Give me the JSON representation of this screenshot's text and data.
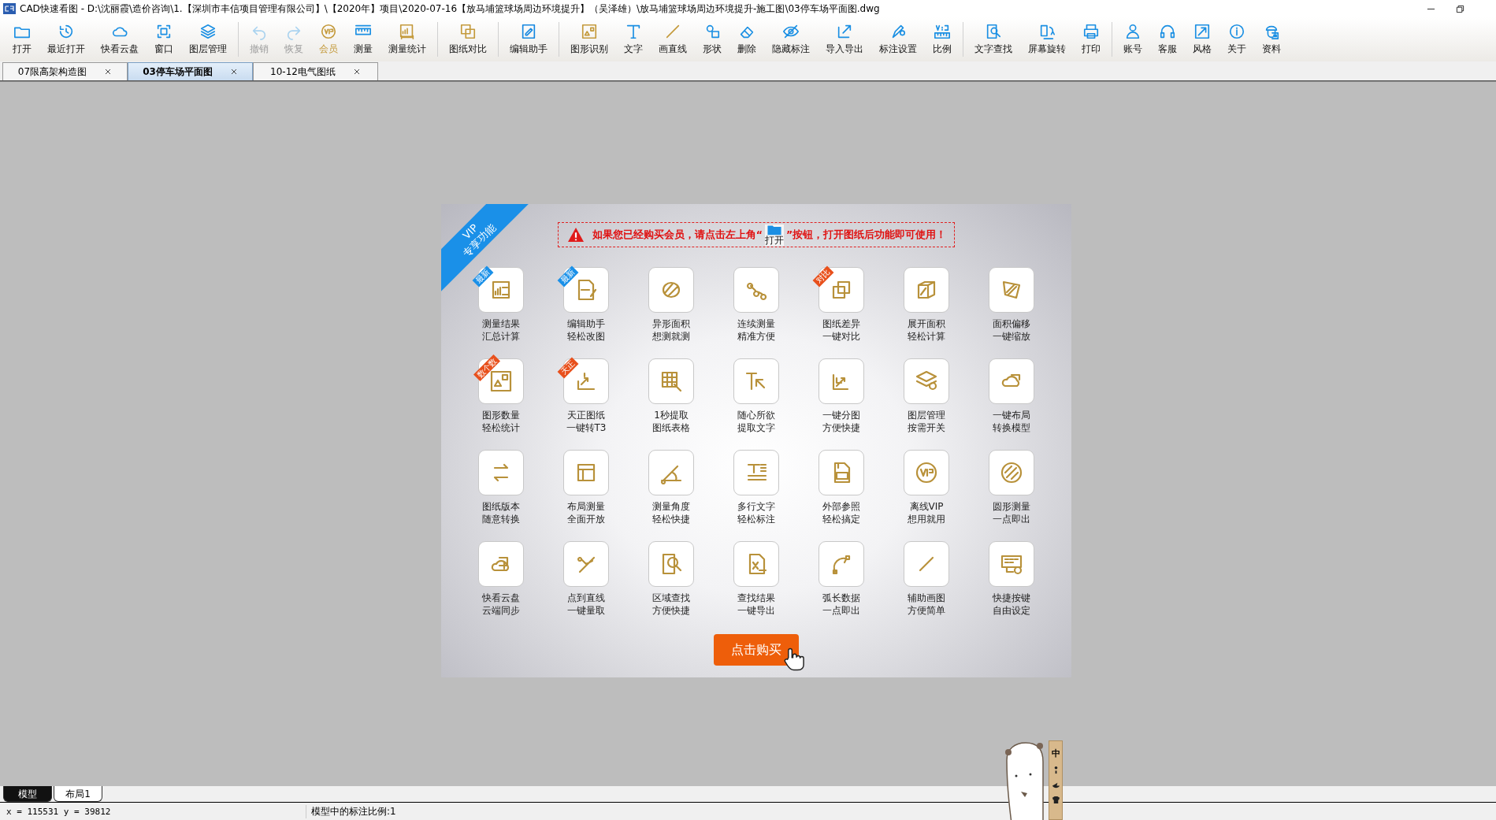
{
  "window": {
    "title": "CAD快速看图 - D:\\沈丽霞\\造价咨询\\1.【深圳市丰信项目管理有限公司】\\【2020年】项目\\2020-07-16【放马埔篮球场周边环境提升】（吴泽雄）\\放马埔篮球场周边环境提升-施工图\\03停车场平面图.dwg"
  },
  "toolbar": [
    {
      "label": "打开",
      "kind": "normal",
      "disabled": false,
      "group_end": false
    },
    {
      "label": "最近打开",
      "kind": "normal",
      "disabled": false,
      "group_end": false
    },
    {
      "label": "快看云盘",
      "kind": "normal",
      "disabled": false,
      "group_end": false
    },
    {
      "label": "窗口",
      "kind": "normal",
      "disabled": false,
      "group_end": false
    },
    {
      "label": "图层管理",
      "kind": "normal",
      "disabled": false,
      "group_end": true
    },
    {
      "label": "撤销",
      "kind": "normal",
      "disabled": true,
      "group_end": false
    },
    {
      "label": "恢复",
      "kind": "normal",
      "disabled": true,
      "group_end": false
    },
    {
      "label": "会员",
      "kind": "member",
      "disabled": false,
      "group_end": false
    },
    {
      "label": "测量",
      "kind": "normal",
      "disabled": false,
      "group_end": false
    },
    {
      "label": "测量统计",
      "kind": "vip",
      "disabled": false,
      "group_end": true
    },
    {
      "label": "图纸对比",
      "kind": "vip",
      "disabled": false,
      "group_end": true
    },
    {
      "label": "编辑助手",
      "kind": "badge",
      "disabled": false,
      "group_end": true
    },
    {
      "label": "图形识别",
      "kind": "vip",
      "disabled": false,
      "group_end": false
    },
    {
      "label": "文字",
      "kind": "normal",
      "disabled": false,
      "group_end": false
    },
    {
      "label": "画直线",
      "kind": "vip",
      "disabled": false,
      "group_end": false
    },
    {
      "label": "形状",
      "kind": "normal",
      "disabled": false,
      "group_end": false
    },
    {
      "label": "删除",
      "kind": "normal",
      "disabled": false,
      "group_end": false
    },
    {
      "label": "隐藏标注",
      "kind": "normal",
      "disabled": false,
      "group_end": false
    },
    {
      "label": "导入导出",
      "kind": "normal",
      "disabled": false,
      "group_end": false
    },
    {
      "label": "标注设置",
      "kind": "normal",
      "disabled": false,
      "group_end": false
    },
    {
      "label": "比例",
      "kind": "normal",
      "disabled": false,
      "group_end": true
    },
    {
      "label": "文字查找",
      "kind": "normal",
      "disabled": false,
      "group_end": false
    },
    {
      "label": "屏幕旋转",
      "kind": "normal",
      "disabled": false,
      "group_end": false
    },
    {
      "label": "打印",
      "kind": "normal",
      "disabled": false,
      "group_end": true
    },
    {
      "label": "账号",
      "kind": "normal",
      "disabled": false,
      "group_end": false
    },
    {
      "label": "客服",
      "kind": "normal",
      "disabled": false,
      "group_end": false
    },
    {
      "label": "风格",
      "kind": "normal",
      "disabled": false,
      "group_end": false
    },
    {
      "label": "关于",
      "kind": "normal",
      "disabled": false,
      "group_end": false
    },
    {
      "label": "资料",
      "kind": "normal",
      "disabled": false,
      "group_end": false
    }
  ],
  "tabs": [
    {
      "label": "07限高架构造图",
      "selected": false
    },
    {
      "label": "03停车场平面图",
      "selected": true
    },
    {
      "label": "10-12电气图纸",
      "selected": false
    }
  ],
  "vip_panel": {
    "ribbon": [
      "VIP",
      "专享功能"
    ],
    "notice": {
      "before": "如果您已经购买会员，请点击左上角“",
      "button_label": "打开",
      "after": "”按钮，打开图纸后功能即可使用！"
    },
    "features": [
      {
        "lines": [
          "测量结果",
          "汇总计算"
        ],
        "badge": {
          "text": "最新",
          "color": "#1a90e8"
        }
      },
      {
        "lines": [
          "编辑助手",
          "轻松改图"
        ],
        "badge": {
          "text": "最新",
          "color": "#1a90e8"
        }
      },
      {
        "lines": [
          "异形面积",
          "想测就测"
        ]
      },
      {
        "lines": [
          "连续测量",
          "精准方便"
        ]
      },
      {
        "lines": [
          "图纸差异",
          "一键对比"
        ],
        "badge": {
          "text": "对比",
          "color": "#e8501c"
        }
      },
      {
        "lines": [
          "展开面积",
          "轻松计算"
        ]
      },
      {
        "lines": [
          "面积偏移",
          "一键缩放"
        ]
      },
      {
        "lines": [
          "图形数量",
          "轻松统计"
        ],
        "badge": {
          "text": "数个数",
          "color": "#e8501c"
        }
      },
      {
        "lines": [
          "天正图纸",
          "一键转T3"
        ],
        "badge": {
          "text": "天正",
          "color": "#e8501c"
        }
      },
      {
        "lines": [
          "1秒提取",
          "图纸表格"
        ]
      },
      {
        "lines": [
          "随心所欲",
          "提取文字"
        ]
      },
      {
        "lines": [
          "一键分图",
          "方便快捷"
        ]
      },
      {
        "lines": [
          "图层管理",
          "按需开关"
        ]
      },
      {
        "lines": [
          "一键布局",
          "转换模型"
        ]
      },
      {
        "lines": [
          "图纸版本",
          "随意转换"
        ]
      },
      {
        "lines": [
          "布局测量",
          "全面开放"
        ]
      },
      {
        "lines": [
          "测量角度",
          "轻松快捷"
        ]
      },
      {
        "lines": [
          "多行文字",
          "轻松标注"
        ]
      },
      {
        "lines": [
          "外部参照",
          "轻松搞定"
        ]
      },
      {
        "lines": [
          "离线VIP",
          "想用就用"
        ]
      },
      {
        "lines": [
          "圆形测量",
          "一点即出"
        ]
      },
      {
        "lines": [
          "快看云盘",
          "云端同步"
        ]
      },
      {
        "lines": [
          "点到直线",
          "一键量取"
        ]
      },
      {
        "lines": [
          "区域查找",
          "方便快捷"
        ]
      },
      {
        "lines": [
          "查找结果",
          "一键导出"
        ]
      },
      {
        "lines": [
          "弧长数据",
          "一点即出"
        ]
      },
      {
        "lines": [
          "辅助画图",
          "方便简单"
        ]
      },
      {
        "lines": [
          "快捷按键",
          "自由设定"
        ]
      }
    ],
    "buy_button": "点击购买"
  },
  "layout_tabs": [
    {
      "label": "模型",
      "selected": true
    },
    {
      "label": "布局1",
      "selected": false
    }
  ],
  "status_bar": {
    "coordinates": "x = 115531 y = 39812",
    "scale": "模型中的标注比例:1"
  },
  "input_widget": {
    "mode": "中"
  }
}
